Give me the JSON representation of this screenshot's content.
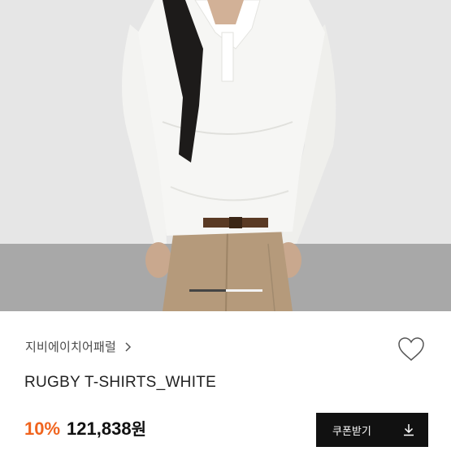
{
  "product": {
    "brand": "지비에이치어패럴",
    "title": "RUGBY T-SHIRTS_WHITE",
    "discount": "10%",
    "price": "121,838",
    "currency": "원"
  },
  "image": {
    "indicator_count": 2,
    "active_index": 1
  },
  "coupon_button": {
    "label": "쿠폰받기",
    "icon": "download-icon"
  },
  "icons": {
    "brand_link": "chevron-right-icon",
    "wishlist": "heart-outline-icon"
  },
  "colors": {
    "discount": "#f0641e",
    "button_bg": "#111111",
    "text": "#222222"
  }
}
